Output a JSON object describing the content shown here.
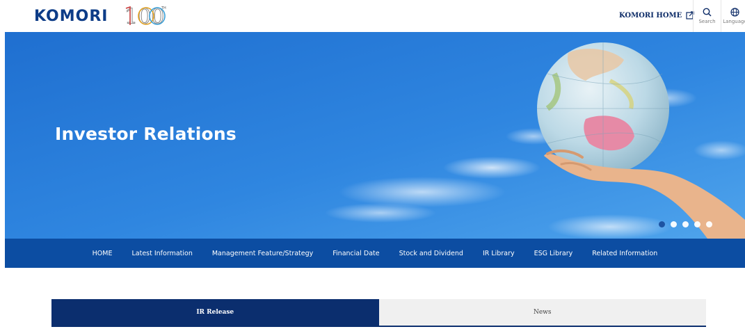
{
  "header": {
    "logo_text": "KOMORI",
    "logo_badge": "100",
    "home_link_label": "KOMORI HOME",
    "search_label": "Search",
    "language_label": "Language"
  },
  "hero": {
    "title": "Investor Relations",
    "slide_count": 5,
    "active_slide": 1
  },
  "nav": {
    "items": [
      {
        "label": "HOME"
      },
      {
        "label": "Latest Information"
      },
      {
        "label": "Management Feature/Strategy"
      },
      {
        "label": "Financial Date"
      },
      {
        "label": "Stock and Dividend"
      },
      {
        "label": "IR Library"
      },
      {
        "label": "ESG Library"
      },
      {
        "label": "Related Information"
      }
    ]
  },
  "tabs": [
    {
      "label": "IR Release",
      "active": true
    },
    {
      "label": "News",
      "active": false
    }
  ],
  "colors": {
    "brand": "#0d3c87",
    "nav": "#0c4da2",
    "tab_active": "#0b2e6e",
    "tab_inactive": "#f0f0f0"
  }
}
